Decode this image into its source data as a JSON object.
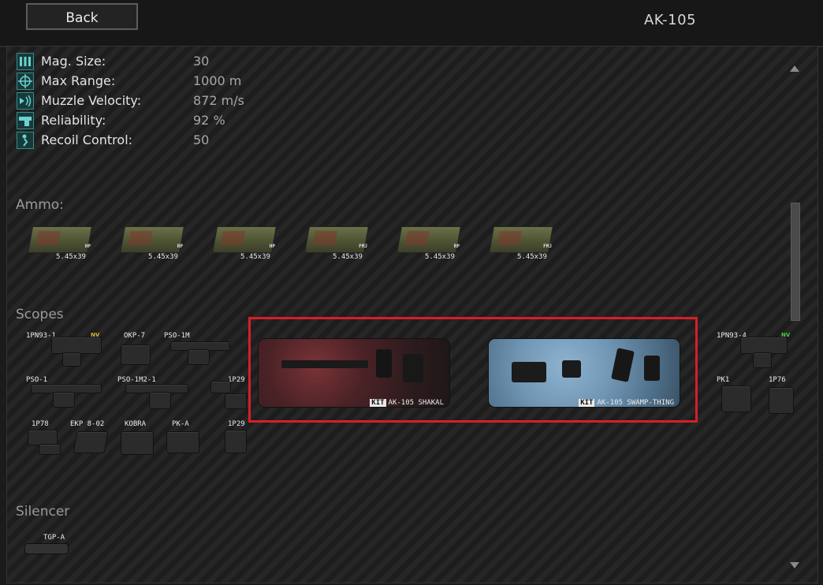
{
  "header": {
    "back_label": "Back",
    "title": "AK-105"
  },
  "stats": [
    {
      "icon": "magazine-icon",
      "label": "Mag. Size:",
      "value": "30"
    },
    {
      "icon": "crosshair-icon",
      "label": "Max Range:",
      "value": "1000 m"
    },
    {
      "icon": "velocity-icon",
      "label": "Muzzle Velocity:",
      "value": "872 m/s"
    },
    {
      "icon": "reliability-icon",
      "label": "Reliability:",
      "value": "92 %"
    },
    {
      "icon": "recoil-icon",
      "label": "Recoil Control:",
      "value": "50"
    }
  ],
  "ammo": {
    "title": "Ammo:",
    "items": [
      {
        "caliber": "5.45x39",
        "type": "HP"
      },
      {
        "caliber": "5.45x39",
        "type": "RP"
      },
      {
        "caliber": "5.45x39",
        "type": "HP"
      },
      {
        "caliber": "5.45x39",
        "type": "FMJ"
      },
      {
        "caliber": "5.45x39",
        "type": "RP"
      },
      {
        "caliber": "5.45x39",
        "type": "FMJ"
      }
    ]
  },
  "scopes": {
    "title": "Scopes",
    "items": [
      {
        "name": "1PN93-1",
        "badge": "NV",
        "badge_color": "#d4b82c"
      },
      {
        "name": "OKP-7"
      },
      {
        "name": "PSO-1M"
      },
      {
        "name": "PSO-1"
      },
      {
        "name": "PSO-1M2-1"
      },
      {
        "name": "1P29"
      },
      {
        "name": "1P78"
      },
      {
        "name": "EKP 8-02"
      },
      {
        "name": "KOBRA"
      },
      {
        "name": "PK-A"
      },
      {
        "name": "1P29"
      },
      {
        "name": "1PN93-4",
        "badge": "NV",
        "badge_color": "#3fcf3f"
      },
      {
        "name": "PK1"
      },
      {
        "name": "1P76"
      }
    ]
  },
  "kits": [
    {
      "tag": "KIT",
      "name": "AK-105 SHAKAL",
      "color": "#5a2a2e"
    },
    {
      "tag": "KIT",
      "name": "AK-105 SWAMP-THING",
      "color": "#6f95b3"
    }
  ],
  "silencer": {
    "title": "Silencer",
    "items": [
      {
        "name": "TGP-A"
      }
    ]
  },
  "colors": {
    "highlight": "#d81e25",
    "stat_icon": "#3a8a8a"
  }
}
